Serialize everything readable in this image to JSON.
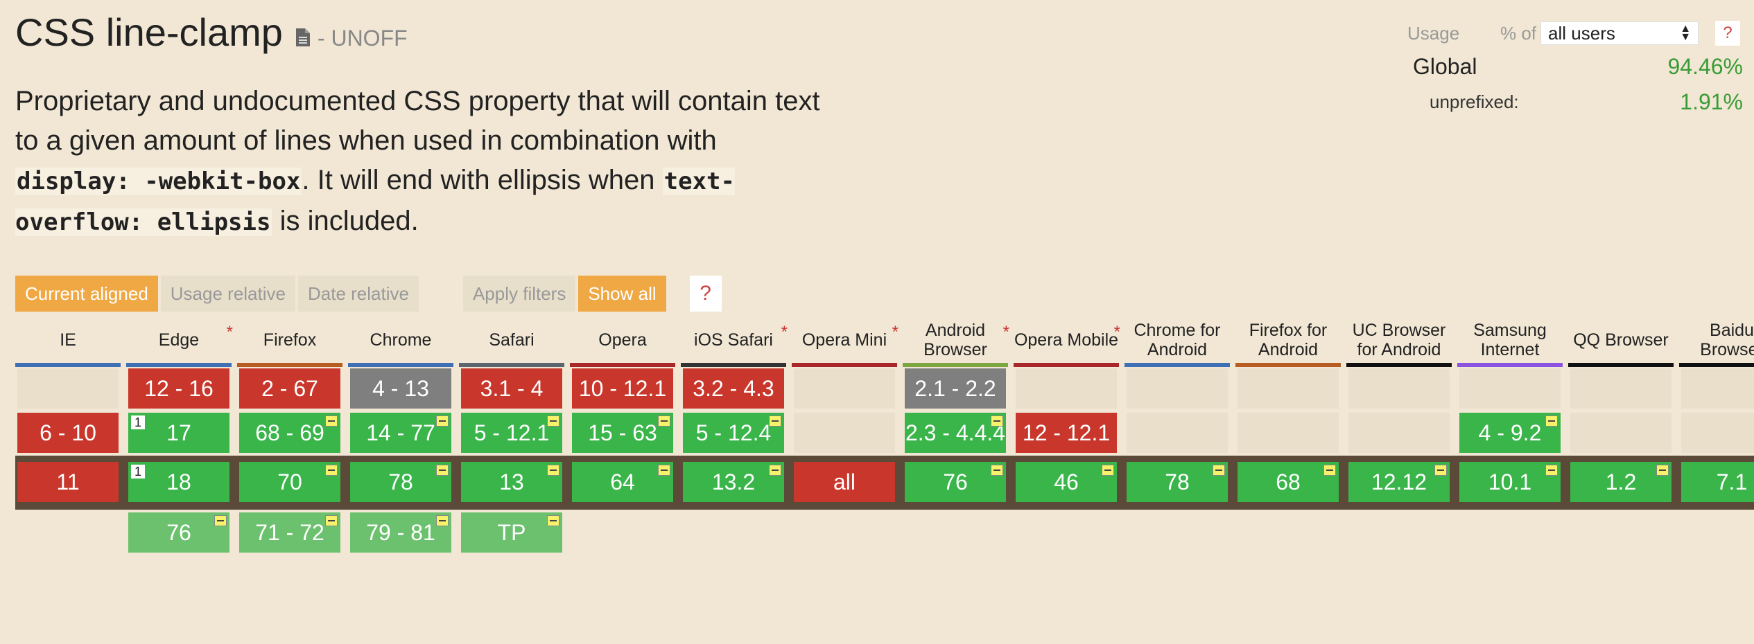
{
  "title": "CSS line-clamp",
  "status": "- UNOFF",
  "description": {
    "p1": "Proprietary and undocumented CSS property that will contain text to a given amount of lines when used in combination with ",
    "code1": "display: -webkit-box",
    "p2": ". It will end with ellipsis when ",
    "code2": "text-overflow: ellipsis",
    "p3": " is included."
  },
  "usage": {
    "label": "Usage",
    "pct_of": "% of",
    "selected": "all users",
    "help": "?",
    "global_label": "Global",
    "global_value": "94.46%",
    "unprefixed_label": "unprefixed:",
    "unprefixed_value": "1.91%"
  },
  "controls": {
    "current_aligned": "Current aligned",
    "usage_relative": "Usage relative",
    "date_relative": "Date relative",
    "apply_filters": "Apply filters",
    "show_all": "Show all",
    "help": "?"
  },
  "colors": {
    "supported": "#39b54a",
    "partial_future": "#6cc16f",
    "unsupported": "#c9372c",
    "unknown": "#7f7f7f",
    "current_band": "#5b4a38",
    "accent": "#f0a844"
  },
  "browsers": [
    {
      "name": "IE",
      "star": false,
      "bar": "#3f6fb5",
      "cells": [
        {
          "row": 0,
          "label": "",
          "status": "empty"
        },
        {
          "row": 1,
          "label": "6 - 10",
          "status": "n"
        },
        {
          "row": 2,
          "label": "11",
          "status": "n"
        }
      ]
    },
    {
      "name": "Edge",
      "star": true,
      "bar": "#3f6fb5",
      "cells": [
        {
          "row": 0,
          "label": "12 - 16",
          "status": "n"
        },
        {
          "row": 1,
          "label": "17",
          "status": "y",
          "note": "1"
        },
        {
          "row": 2,
          "label": "18",
          "status": "y",
          "note": "1"
        },
        {
          "row": 3,
          "label": "76",
          "status": "f",
          "partial": true
        }
      ]
    },
    {
      "name": "Firefox",
      "star": false,
      "bar": "#b75d21",
      "cells": [
        {
          "row": 0,
          "label": "2 - 67",
          "status": "n"
        },
        {
          "row": 1,
          "label": "68 - 69",
          "status": "y",
          "partial": true
        },
        {
          "row": 2,
          "label": "70",
          "status": "y",
          "partial": true
        },
        {
          "row": 3,
          "label": "71 - 72",
          "status": "f",
          "partial": true
        }
      ]
    },
    {
      "name": "Chrome",
      "star": false,
      "bar": "#3f6fb5",
      "cells": [
        {
          "row": 0,
          "label": "4 - 13",
          "status": "u"
        },
        {
          "row": 1,
          "label": "14 - 77",
          "status": "y",
          "partial": true
        },
        {
          "row": 2,
          "label": "78",
          "status": "y",
          "partial": true
        },
        {
          "row": 3,
          "label": "79 - 81",
          "status": "f",
          "partial": true
        }
      ]
    },
    {
      "name": "Safari",
      "star": false,
      "bar": "#5e6470",
      "cells": [
        {
          "row": 0,
          "label": "3.1 - 4",
          "status": "n"
        },
        {
          "row": 1,
          "label": "5 - 12.1",
          "status": "y",
          "partial": true
        },
        {
          "row": 2,
          "label": "13",
          "status": "y",
          "partial": true
        },
        {
          "row": 3,
          "label": "TP",
          "status": "f",
          "partial": true
        }
      ]
    },
    {
      "name": "Opera",
      "star": false,
      "bar": "#a8282a",
      "cells": [
        {
          "row": 0,
          "label": "10 - 12.1",
          "status": "n"
        },
        {
          "row": 1,
          "label": "15 - 63",
          "status": "y",
          "partial": true
        },
        {
          "row": 2,
          "label": "64",
          "status": "y",
          "partial": true
        }
      ]
    },
    {
      "name": "iOS Safari",
      "star": true,
      "bar": "#333333",
      "cells": [
        {
          "row": 0,
          "label": "3.2 - 4.3",
          "status": "n"
        },
        {
          "row": 1,
          "label": "5 - 12.4",
          "status": "y",
          "partial": true
        },
        {
          "row": 2,
          "label": "13.2",
          "status": "y",
          "partial": true
        }
      ]
    },
    {
      "name": "Opera Mini",
      "star": true,
      "bar": "#a8282a",
      "cells": [
        {
          "row": 0,
          "label": "",
          "status": "empty"
        },
        {
          "row": 1,
          "label": "",
          "status": "empty"
        },
        {
          "row": 2,
          "label": "all",
          "status": "n"
        }
      ]
    },
    {
      "name": "Android Browser",
      "star": true,
      "bar": "#7da640",
      "cells": [
        {
          "row": 0,
          "label": "2.1 - 2.2",
          "status": "u"
        },
        {
          "row": 1,
          "label": "2.3 - 4.4.4",
          "status": "y",
          "partial": true
        },
        {
          "row": 2,
          "label": "76",
          "status": "y",
          "partial": true
        }
      ]
    },
    {
      "name": "Opera Mobile",
      "star": true,
      "bar": "#a8282a",
      "cells": [
        {
          "row": 0,
          "label": "",
          "status": "empty"
        },
        {
          "row": 1,
          "label": "12 - 12.1",
          "status": "n"
        },
        {
          "row": 2,
          "label": "46",
          "status": "y",
          "partial": true
        }
      ]
    },
    {
      "name": "Chrome for Android",
      "star": false,
      "bar": "#3f6fb5",
      "cells": [
        {
          "row": 0,
          "label": "",
          "status": "empty"
        },
        {
          "row": 1,
          "label": "",
          "status": "empty"
        },
        {
          "row": 2,
          "label": "78",
          "status": "y",
          "partial": true
        }
      ]
    },
    {
      "name": "Firefox for Android",
      "star": false,
      "bar": "#b75d21",
      "cells": [
        {
          "row": 0,
          "label": "",
          "status": "empty"
        },
        {
          "row": 1,
          "label": "",
          "status": "empty"
        },
        {
          "row": 2,
          "label": "68",
          "status": "y",
          "partial": true
        }
      ]
    },
    {
      "name": "UC Browser for Android",
      "star": false,
      "bar": "#111111",
      "cells": [
        {
          "row": 0,
          "label": "",
          "status": "empty"
        },
        {
          "row": 1,
          "label": "",
          "status": "empty"
        },
        {
          "row": 2,
          "label": "12.12",
          "status": "y",
          "partial": true
        }
      ]
    },
    {
      "name": "Samsung Internet",
      "star": false,
      "bar": "#8a53e0",
      "cells": [
        {
          "row": 0,
          "label": "",
          "status": "empty"
        },
        {
          "row": 1,
          "label": "4 - 9.2",
          "status": "y",
          "partial": true
        },
        {
          "row": 2,
          "label": "10.1",
          "status": "y",
          "partial": true
        }
      ]
    },
    {
      "name": "QQ Browser",
      "star": false,
      "bar": "#111111",
      "cells": [
        {
          "row": 0,
          "label": "",
          "status": "empty"
        },
        {
          "row": 1,
          "label": "",
          "status": "empty"
        },
        {
          "row": 2,
          "label": "1.2",
          "status": "y",
          "partial": true
        }
      ]
    },
    {
      "name": "Baidu Browser",
      "star": false,
      "bar": "#111111",
      "cells": [
        {
          "row": 0,
          "label": "",
          "status": "empty"
        },
        {
          "row": 1,
          "label": "",
          "status": "empty"
        },
        {
          "row": 2,
          "label": "7.1",
          "status": "y",
          "partial": true
        }
      ]
    }
  ]
}
